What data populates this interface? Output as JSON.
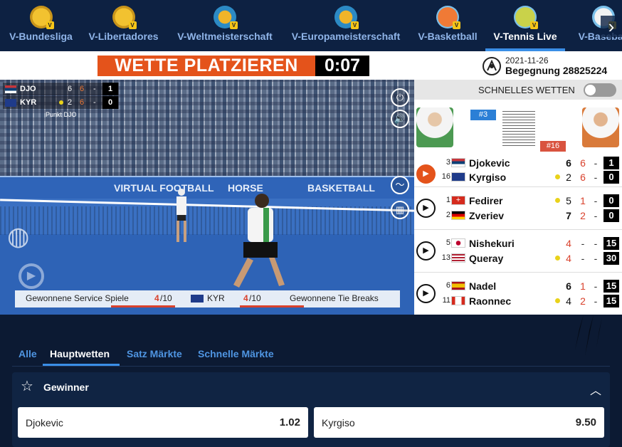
{
  "nav": {
    "items": [
      {
        "label": "V-Bundesliga",
        "icon": "jersey-icon",
        "active": false
      },
      {
        "label": "V-Libertadores",
        "icon": "jersey-icon",
        "active": false
      },
      {
        "label": "V-Weltmeisterschaft",
        "icon": "trophy-icon",
        "active": false
      },
      {
        "label": "V-Europameisterschaft",
        "icon": "trophy-icon",
        "active": false
      },
      {
        "label": "V-Basketball",
        "icon": "basketball-icon",
        "active": false
      },
      {
        "label": "V-Tennis Live",
        "icon": "tennis-ball-icon",
        "active": true
      },
      {
        "label": "V-Baseball",
        "icon": "baseball-icon",
        "active": false
      }
    ],
    "badge": "V"
  },
  "header": {
    "cta": "WETTE PLATZIEREN",
    "timer": "0:07",
    "date": "2021-11-26",
    "match": "Begegnung 28825224"
  },
  "video": {
    "score": [
      {
        "code": "DJO",
        "set1": "6",
        "set2": "6",
        "dash": "-",
        "pts": "1"
      },
      {
        "code": "KYR",
        "set1": "2",
        "set2": "6",
        "dash": "-",
        "pts": "0"
      }
    ],
    "punkt": "Punkt DJO",
    "board": [
      "VIRTUAL FOOTBALL",
      "HORSE",
      "BASKETBALL"
    ],
    "stats": {
      "left_label": "Gewonnene Service Spiele",
      "left_val": "4",
      "left_total": "/10",
      "code": "KYR",
      "right_val": "4",
      "right_total": "/10",
      "right_label": "Gewonnene Tie Breaks"
    }
  },
  "panel": {
    "quick_label": "SCHNELLES WETTEN",
    "rank_a": "#3",
    "rank_b": "#16",
    "matches": [
      {
        "live": true,
        "players": [
          {
            "seed": "3",
            "name": "Djokevic",
            "flag": "serbia",
            "serve": false,
            "s1": "6",
            "s2": "6",
            "s3": "-",
            "pt": "1"
          },
          {
            "seed": "16",
            "name": "Kyrgiso",
            "flag": "australia",
            "serve": true,
            "s1": "2",
            "s2": "6",
            "s3": "-",
            "pt": "0"
          }
        ]
      },
      {
        "live": false,
        "players": [
          {
            "seed": "1",
            "name": "Fedirer",
            "flag": "switzerland",
            "serve": true,
            "s1": "5",
            "s2": "1",
            "s3": "-",
            "pt": "0"
          },
          {
            "seed": "2",
            "name": "Zveriev",
            "flag": "germany",
            "serve": false,
            "s1": "7",
            "s2": "2",
            "s3": "-",
            "pt": "0"
          }
        ]
      },
      {
        "live": false,
        "players": [
          {
            "seed": "5",
            "name": "Nishekuri",
            "flag": "japan",
            "serve": false,
            "s1": "4",
            "s2": "-",
            "s3": "-",
            "pt": "15"
          },
          {
            "seed": "13",
            "name": "Queray",
            "flag": "usa",
            "serve": true,
            "s1": "4",
            "s2": "-",
            "s3": "-",
            "pt": "30"
          }
        ]
      },
      {
        "live": false,
        "players": [
          {
            "seed": "6",
            "name": "Nadel",
            "flag": "spain",
            "serve": false,
            "s1": "6",
            "s2": "1",
            "s3": "-",
            "pt": "15"
          },
          {
            "seed": "11",
            "name": "Raonnec",
            "flag": "canada",
            "serve": true,
            "s1": "4",
            "s2": "2",
            "s3": "-",
            "pt": "15"
          }
        ]
      }
    ]
  },
  "tabs": [
    {
      "label": "Alle",
      "active": false
    },
    {
      "label": "Hauptwetten",
      "active": true
    },
    {
      "label": "Satz Märkte",
      "active": false
    },
    {
      "label": "Schnelle Märkte",
      "active": false
    }
  ],
  "market": {
    "title": "Gewinner",
    "odds": [
      {
        "name": "Djokevic",
        "price": "1.02"
      },
      {
        "name": "Kyrgiso",
        "price": "9.50"
      }
    ]
  },
  "colors": {
    "accent": "#e4531b",
    "blue": "#3a8ee6",
    "bg": "#0c1a33"
  }
}
